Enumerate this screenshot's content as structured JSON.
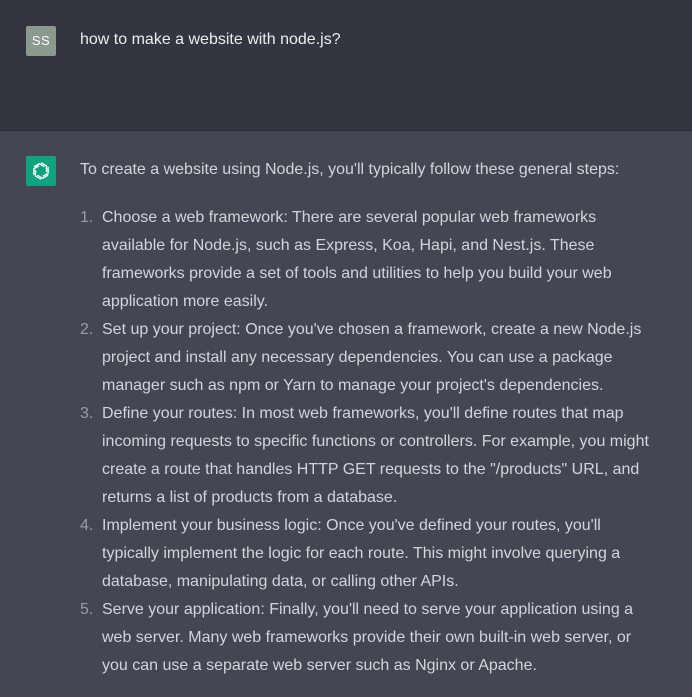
{
  "user_message": {
    "avatar_initials": "SS",
    "text": "how to make a website with node.js?"
  },
  "assistant_message": {
    "avatar_icon": "openai-logo-icon",
    "intro": "To create a website using Node.js, you'll typically follow these general steps:",
    "steps": [
      {
        "number": "1.",
        "text": "Choose a web framework: There are several popular web frameworks available for Node.js, such as Express, Koa, Hapi, and Nest.js. These frameworks provide a set of tools and utilities to help you build your web application more easily."
      },
      {
        "number": "2.",
        "text": "Set up your project: Once you've chosen a framework, create a new Node.js project and install any necessary dependencies. You can use a package manager such as npm or Yarn to manage your project's dependencies."
      },
      {
        "number": "3.",
        "text": "Define your routes: In most web frameworks, you'll define routes that map incoming requests to specific functions or controllers. For example, you might create a route that handles HTTP GET requests to the \"/products\" URL, and returns a list of products from a database."
      },
      {
        "number": "4.",
        "text": "Implement your business logic: Once you've defined your routes, you'll typically implement the logic for each route. This might involve querying a database, manipulating data, or calling other APIs."
      },
      {
        "number": "5.",
        "text": "Serve your application: Finally, you'll need to serve your application using a web server. Many web frameworks provide their own built-in web server, or you can use a separate web server such as Nginx or Apache."
      }
    ]
  },
  "colors": {
    "user_bg": "#343541",
    "assistant_bg": "#444654",
    "brand_green": "#10a37f",
    "text": "#d1d5db"
  }
}
